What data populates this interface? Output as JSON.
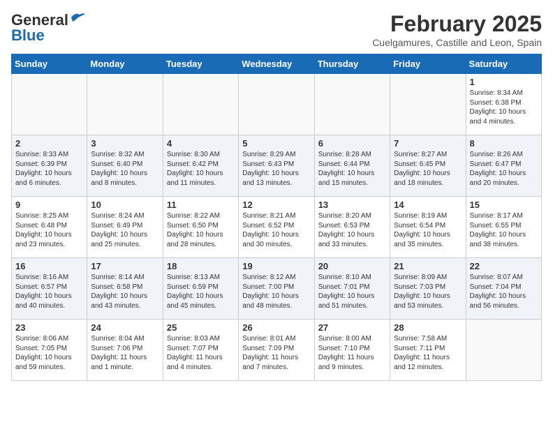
{
  "header": {
    "logo_line1": "General",
    "logo_line2": "Blue",
    "month": "February 2025",
    "location": "Cuelgamures, Castille and Leon, Spain"
  },
  "weekdays": [
    "Sunday",
    "Monday",
    "Tuesday",
    "Wednesday",
    "Thursday",
    "Friday",
    "Saturday"
  ],
  "weeks": [
    [
      {
        "day": "",
        "info": ""
      },
      {
        "day": "",
        "info": ""
      },
      {
        "day": "",
        "info": ""
      },
      {
        "day": "",
        "info": ""
      },
      {
        "day": "",
        "info": ""
      },
      {
        "day": "",
        "info": ""
      },
      {
        "day": "1",
        "info": "Sunrise: 8:34 AM\nSunset: 6:38 PM\nDaylight: 10 hours\nand 4 minutes."
      }
    ],
    [
      {
        "day": "2",
        "info": "Sunrise: 8:33 AM\nSunset: 6:39 PM\nDaylight: 10 hours\nand 6 minutes."
      },
      {
        "day": "3",
        "info": "Sunrise: 8:32 AM\nSunset: 6:40 PM\nDaylight: 10 hours\nand 8 minutes."
      },
      {
        "day": "4",
        "info": "Sunrise: 8:30 AM\nSunset: 6:42 PM\nDaylight: 10 hours\nand 11 minutes."
      },
      {
        "day": "5",
        "info": "Sunrise: 8:29 AM\nSunset: 6:43 PM\nDaylight: 10 hours\nand 13 minutes."
      },
      {
        "day": "6",
        "info": "Sunrise: 8:28 AM\nSunset: 6:44 PM\nDaylight: 10 hours\nand 15 minutes."
      },
      {
        "day": "7",
        "info": "Sunrise: 8:27 AM\nSunset: 6:45 PM\nDaylight: 10 hours\nand 18 minutes."
      },
      {
        "day": "8",
        "info": "Sunrise: 8:26 AM\nSunset: 6:47 PM\nDaylight: 10 hours\nand 20 minutes."
      }
    ],
    [
      {
        "day": "9",
        "info": "Sunrise: 8:25 AM\nSunset: 6:48 PM\nDaylight: 10 hours\nand 23 minutes."
      },
      {
        "day": "10",
        "info": "Sunrise: 8:24 AM\nSunset: 6:49 PM\nDaylight: 10 hours\nand 25 minutes."
      },
      {
        "day": "11",
        "info": "Sunrise: 8:22 AM\nSunset: 6:50 PM\nDaylight: 10 hours\nand 28 minutes."
      },
      {
        "day": "12",
        "info": "Sunrise: 8:21 AM\nSunset: 6:52 PM\nDaylight: 10 hours\nand 30 minutes."
      },
      {
        "day": "13",
        "info": "Sunrise: 8:20 AM\nSunset: 6:53 PM\nDaylight: 10 hours\nand 33 minutes."
      },
      {
        "day": "14",
        "info": "Sunrise: 8:19 AM\nSunset: 6:54 PM\nDaylight: 10 hours\nand 35 minutes."
      },
      {
        "day": "15",
        "info": "Sunrise: 8:17 AM\nSunset: 6:55 PM\nDaylight: 10 hours\nand 38 minutes."
      }
    ],
    [
      {
        "day": "16",
        "info": "Sunrise: 8:16 AM\nSunset: 6:57 PM\nDaylight: 10 hours\nand 40 minutes."
      },
      {
        "day": "17",
        "info": "Sunrise: 8:14 AM\nSunset: 6:58 PM\nDaylight: 10 hours\nand 43 minutes."
      },
      {
        "day": "18",
        "info": "Sunrise: 8:13 AM\nSunset: 6:59 PM\nDaylight: 10 hours\nand 45 minutes."
      },
      {
        "day": "19",
        "info": "Sunrise: 8:12 AM\nSunset: 7:00 PM\nDaylight: 10 hours\nand 48 minutes."
      },
      {
        "day": "20",
        "info": "Sunrise: 8:10 AM\nSunset: 7:01 PM\nDaylight: 10 hours\nand 51 minutes."
      },
      {
        "day": "21",
        "info": "Sunrise: 8:09 AM\nSunset: 7:03 PM\nDaylight: 10 hours\nand 53 minutes."
      },
      {
        "day": "22",
        "info": "Sunrise: 8:07 AM\nSunset: 7:04 PM\nDaylight: 10 hours\nand 56 minutes."
      }
    ],
    [
      {
        "day": "23",
        "info": "Sunrise: 8:06 AM\nSunset: 7:05 PM\nDaylight: 10 hours\nand 59 minutes."
      },
      {
        "day": "24",
        "info": "Sunrise: 8:04 AM\nSunset: 7:06 PM\nDaylight: 11 hours\nand 1 minute."
      },
      {
        "day": "25",
        "info": "Sunrise: 8:03 AM\nSunset: 7:07 PM\nDaylight: 11 hours\nand 4 minutes."
      },
      {
        "day": "26",
        "info": "Sunrise: 8:01 AM\nSunset: 7:09 PM\nDaylight: 11 hours\nand 7 minutes."
      },
      {
        "day": "27",
        "info": "Sunrise: 8:00 AM\nSunset: 7:10 PM\nDaylight: 11 hours\nand 9 minutes."
      },
      {
        "day": "28",
        "info": "Sunrise: 7:58 AM\nSunset: 7:11 PM\nDaylight: 11 hours\nand 12 minutes."
      },
      {
        "day": "",
        "info": ""
      }
    ]
  ]
}
